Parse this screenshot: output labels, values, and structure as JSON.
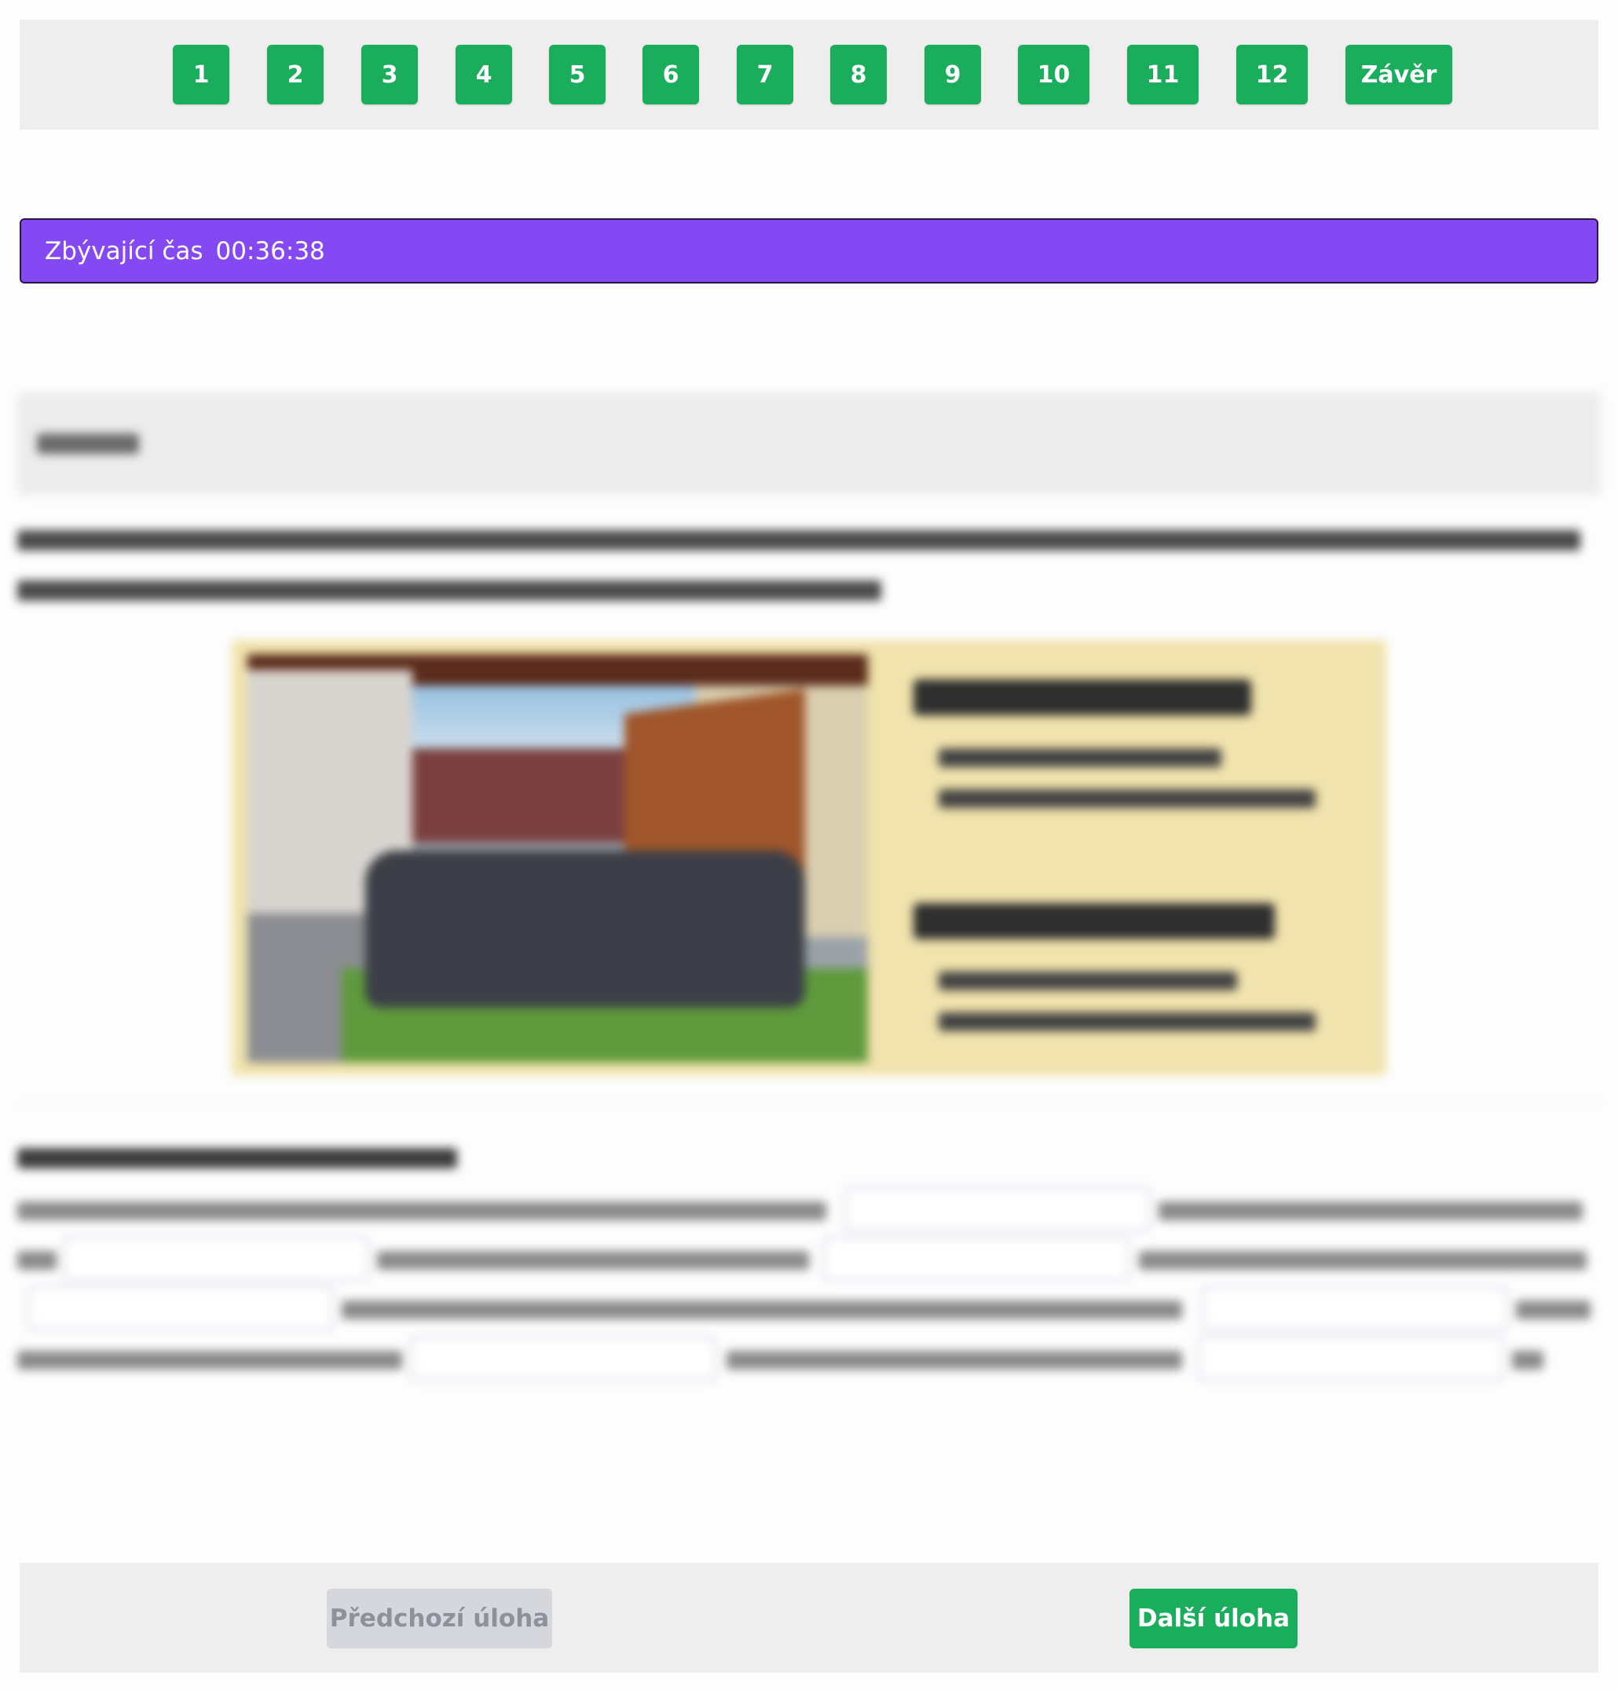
{
  "nav": {
    "tasks": [
      "1",
      "2",
      "3",
      "4",
      "5",
      "6",
      "7",
      "8",
      "9",
      "10",
      "11",
      "12"
    ],
    "conclusion_label": "Závěr"
  },
  "timer": {
    "label": "Zbývající čas",
    "value": "00:36:38"
  },
  "footer": {
    "prev_label": "Předchozí úloha",
    "next_label": "Další úloha"
  },
  "colors": {
    "primary_green": "#1aad5c",
    "timer_purple": "#8549f4",
    "disabled_gray": "#d5d7dc"
  }
}
